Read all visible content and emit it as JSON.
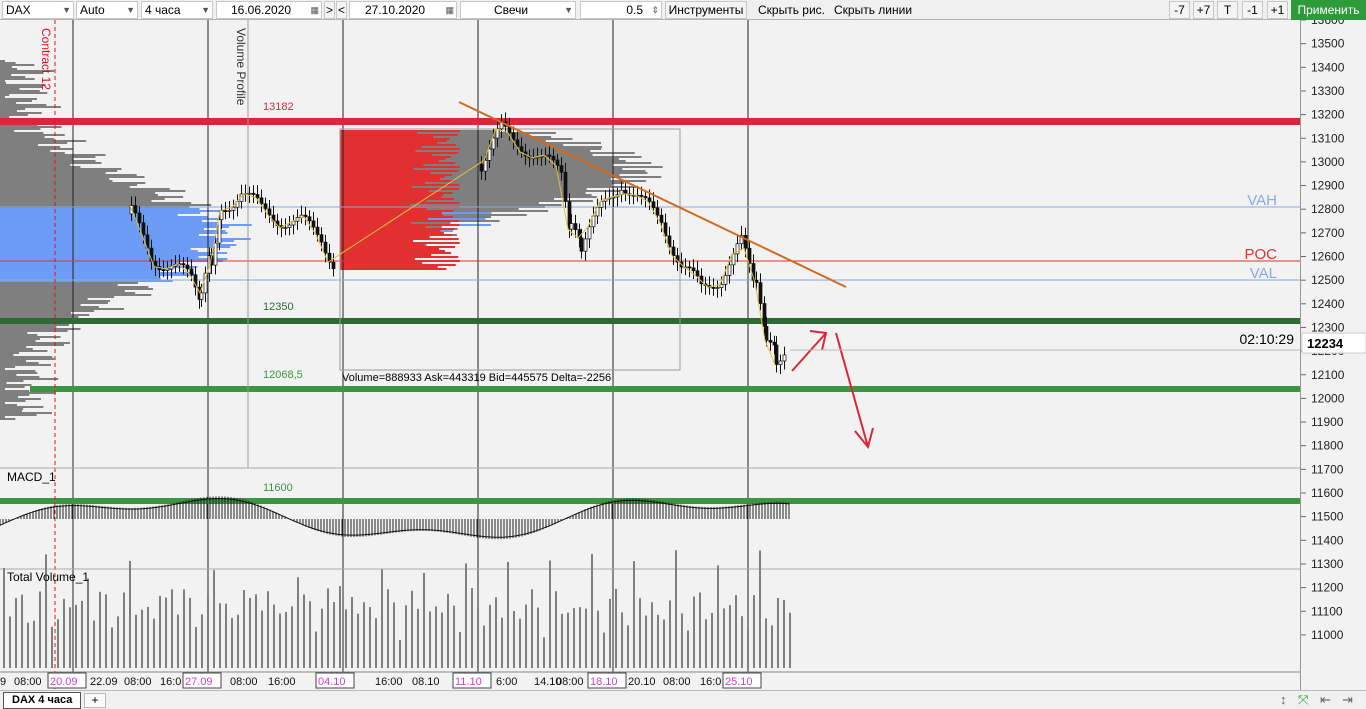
{
  "toolbar": {
    "symbol": "DAX",
    "scale": "Auto",
    "timeframe": "4 часа",
    "date_from": "16.06.2020",
    "nav_right": ">",
    "nav_left": "<",
    "date_to": "27.10.2020",
    "chart_type": "Свечи",
    "step": "0.5",
    "instruments": "Инструменты",
    "hide_drawings": "Скрыть рис.",
    "hide_lines": "Скрыть линии",
    "zoom_minus7": "-7",
    "zoom_plus7": "+7",
    "t_button": "T",
    "minus1": "-1",
    "plus1": "+1",
    "apply": "Применить"
  },
  "chart_labels": {
    "contract": "Contract 12",
    "volume_profile": "Volume Profile",
    "level_13182": "13182",
    "level_12350": "12350",
    "level_12068": "12068,5",
    "level_11600": "11600",
    "vah": "VAH",
    "poc": "POC",
    "val": "VAL",
    "timer": "02:10:29",
    "stats": "Volume=888933  Ask=443319  Bid=445575  Delta=-2256",
    "macd": "MACD_1",
    "total_volume": "Total Volume_1"
  },
  "colors": {
    "red_level": "#d9273a",
    "dark_green_level": "#2d6a35",
    "green_level": "#3c963f",
    "va_blue": "#8aa9e0",
    "poc_red": "#e23030",
    "trend_orange": "#d2691e",
    "profile_gray": "#7f7f7f",
    "profile_blue": "#6d9cf7",
    "apply_green": "#2e9b3a"
  },
  "price_axis": {
    "ticks": [
      "13600",
      "13500",
      "13400",
      "13300",
      "13200",
      "13100",
      "13000",
      "12900",
      "12800",
      "12700",
      "12600",
      "12500",
      "12400",
      "12300",
      "12200",
      "12100",
      "12000",
      "11900",
      "11800",
      "11700",
      "11600",
      "11500",
      "11400",
      "11300",
      "11200",
      "11100",
      "11000"
    ],
    "current_price": "12234"
  },
  "time_axis": [
    {
      "label": "9",
      "highlight": false
    },
    {
      "label": "08:00",
      "highlight": false
    },
    {
      "label": "20.09",
      "highlight": true
    },
    {
      "label": "22.09",
      "highlight": false
    },
    {
      "label": "08:00",
      "highlight": false
    },
    {
      "label": "16:0",
      "highlight": false
    },
    {
      "label": "27.09",
      "highlight": true
    },
    {
      "label": "08:00",
      "highlight": false
    },
    {
      "label": "16:00",
      "highlight": false
    },
    {
      "label": "02",
      "highlight": false
    },
    {
      "label": "04.10",
      "highlight": true
    },
    {
      "label": "16:00",
      "highlight": false
    },
    {
      "label": "08.10",
      "highlight": false
    },
    {
      "label": "11.10",
      "highlight": true
    },
    {
      "label": "6:00",
      "highlight": false
    },
    {
      "label": "14.10",
      "highlight": false
    },
    {
      "label": "08:00",
      "highlight": false
    },
    {
      "label": "18.10",
      "highlight": true
    },
    {
      "label": "20.10",
      "highlight": false
    },
    {
      "label": "08:00",
      "highlight": false
    },
    {
      "label": "16:0",
      "highlight": false
    },
    {
      "label": "25.10",
      "highlight": true
    }
  ],
  "bottom": {
    "tab_label": "DAX 4 часа",
    "add_tab": "+",
    "icons": [
      "resize-vertical-icon",
      "fit-icon",
      "scroll-left-icon",
      "scroll-right-icon"
    ]
  }
}
